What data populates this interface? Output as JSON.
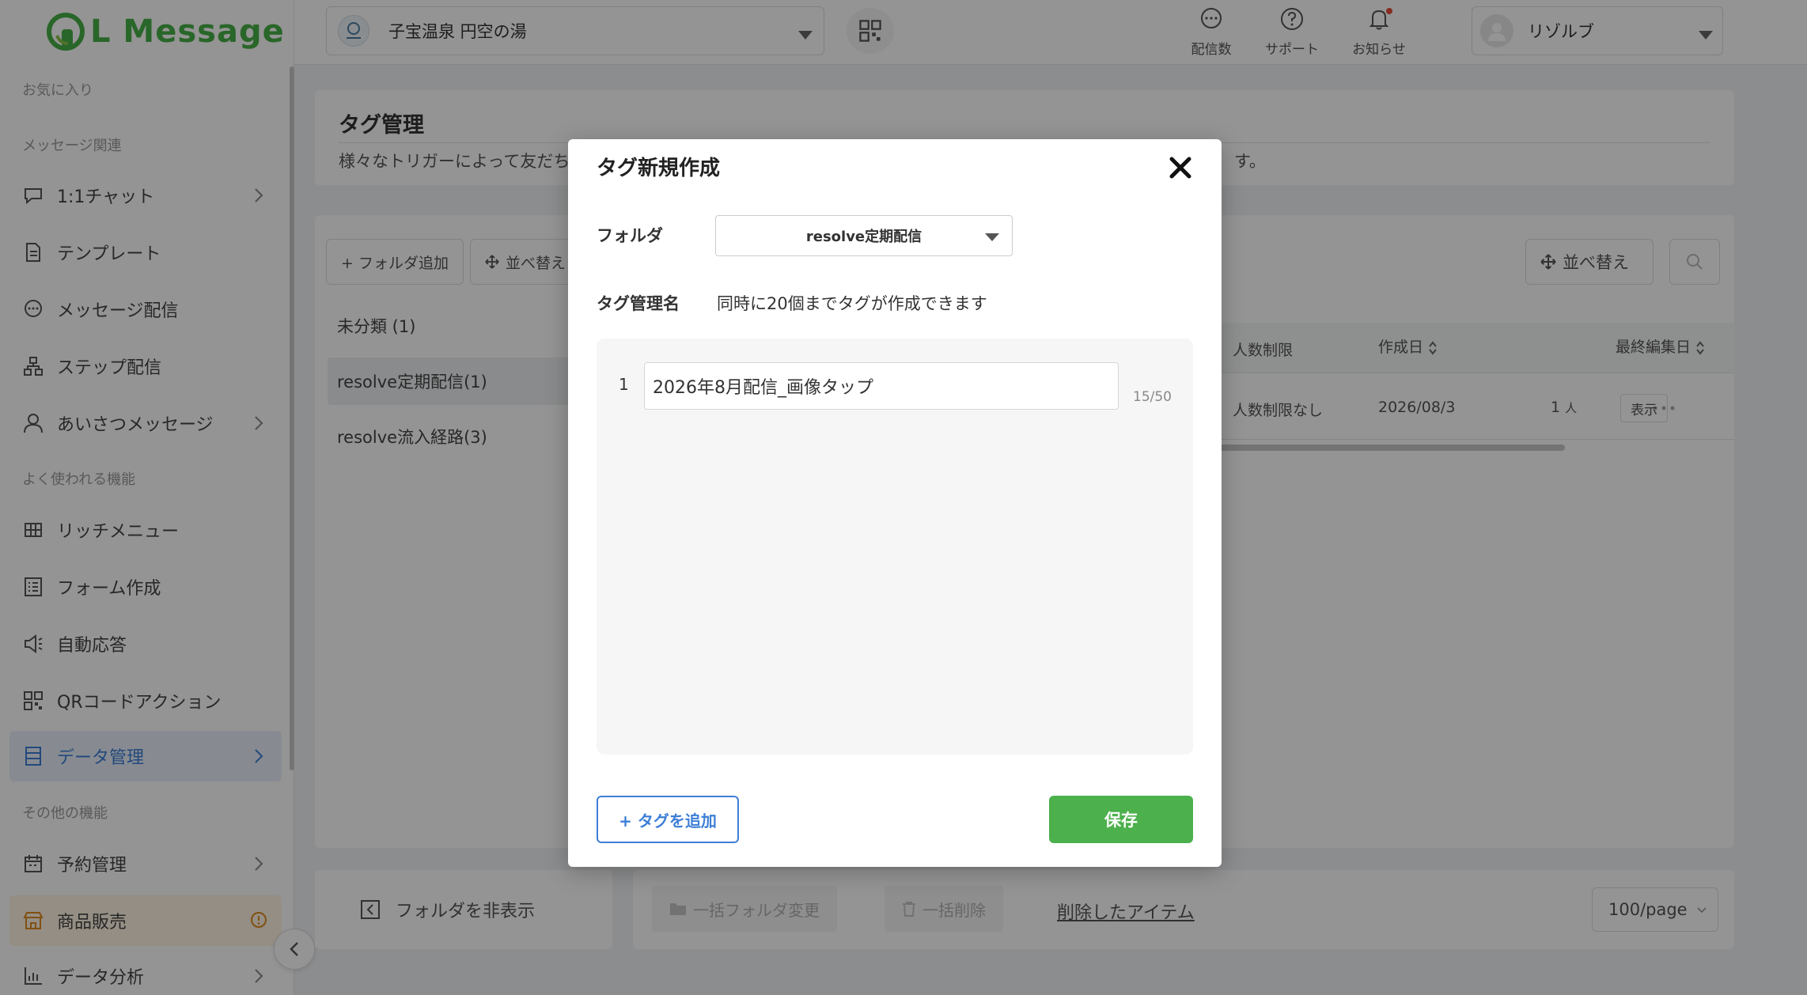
{
  "app": {
    "logo_text": "L Message"
  },
  "sidebar": {
    "sections": {
      "favorites": "お気に入り",
      "message": "メッセージ関連",
      "frequent": "よく使われる機能",
      "other": "その他の機能"
    },
    "items": [
      {
        "label": "1:1チャット",
        "icon": "chat-icon"
      },
      {
        "label": "テンプレート",
        "icon": "document-icon"
      },
      {
        "label": "メッセージ配信",
        "icon": "message-icon"
      },
      {
        "label": "ステップ配信",
        "icon": "step-icon"
      },
      {
        "label": "あいさつメッセージ",
        "icon": "user-icon"
      },
      {
        "label": "リッチメニュー",
        "icon": "grid-icon"
      },
      {
        "label": "フォーム作成",
        "icon": "form-icon"
      },
      {
        "label": "自動応答",
        "icon": "speaker-icon"
      },
      {
        "label": "QRコードアクション",
        "icon": "qr-icon"
      },
      {
        "label": "データ管理",
        "icon": "database-icon"
      },
      {
        "label": "予約管理",
        "icon": "calendar-icon"
      },
      {
        "label": "商品販売",
        "icon": "store-icon"
      },
      {
        "label": "データ分析",
        "icon": "chart-icon"
      }
    ]
  },
  "header": {
    "account_name": "子宝温泉 円空の湯",
    "icons": [
      {
        "label": "配信数",
        "icon": "message-count-icon"
      },
      {
        "label": "サポート",
        "icon": "help-icon"
      },
      {
        "label": "お知らせ",
        "icon": "bell-icon"
      }
    ],
    "user_name": "リゾルブ"
  },
  "page": {
    "title": "タグ管理",
    "description": "様々なトリガーによって友だち",
    "description_tail": "す。",
    "add_folder": "+ フォルダ追加",
    "sort_left": "並べ替え",
    "sort_right": "並べ替え",
    "folders": [
      "未分類 (1)",
      "resolve定期配信(1)",
      "resolve流入経路(3)"
    ],
    "table": {
      "headers": [
        "人数制限",
        "作成日",
        "最終編集日"
      ],
      "row": {
        "limit": "人数制限なし",
        "created": "2026/08/3",
        "count": "1",
        "count_unit": "人",
        "show": "表示"
      }
    },
    "hide_folder": "フォルダを非表示",
    "bulk_folder_change": "一括フォルダ変更",
    "bulk_delete": "一括削除",
    "deleted_items": "削除したアイテム",
    "page_size": "100/page"
  },
  "modal": {
    "title": "タグ新規作成",
    "folder_label": "フォルダ",
    "folder_value": "resolve定期配信",
    "tagname_label": "タグ管理名",
    "tagname_hint": "同時に20個までタグが作成できます",
    "tags": [
      {
        "index": "1",
        "value": "2026年8月配信_画像タップ",
        "count": "15/50"
      }
    ],
    "add_tag": "+ タグを追加",
    "save": "保存"
  },
  "colors": {
    "brand_green": "#48b048",
    "accent_blue": "#3d7fd6",
    "save_green": "#4cb04c"
  }
}
